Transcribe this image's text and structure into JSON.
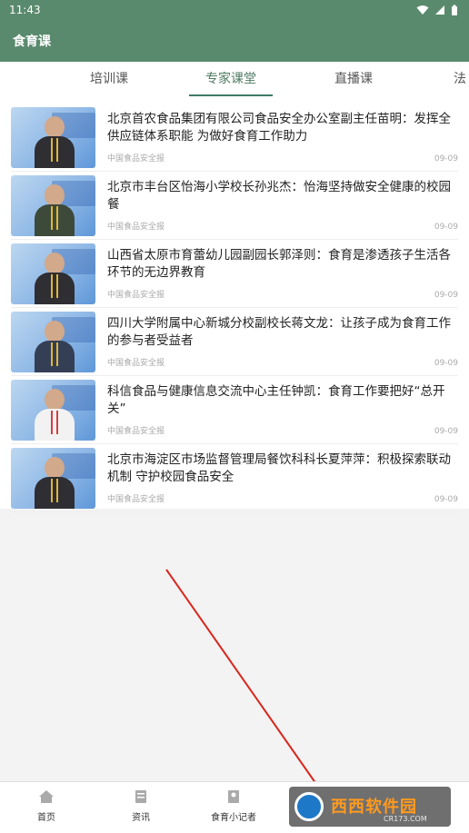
{
  "status": {
    "time": "11:43"
  },
  "app": {
    "title": "食育课"
  },
  "tabs": [
    {
      "label": "培训课"
    },
    {
      "label": "专家课堂",
      "active": true
    },
    {
      "label": "直播课"
    },
    {
      "label": "法"
    }
  ],
  "articles": [
    {
      "title": "北京首农食品集团有限公司食品安全办公室副主任苗明：发挥全供应链体系职能 为做好食育工作助力",
      "source": "中国食品安全报",
      "date": "09-09"
    },
    {
      "title": "北京市丰台区怡海小学校长孙兆杰：怡海坚持做安全健康的校园餐",
      "source": "中国食品安全报",
      "date": "09-09"
    },
    {
      "title": "山西省太原市育蕾幼儿园副园长郭泽则：食育是渗透孩子生活各环节的无边界教育",
      "source": "中国食品安全报",
      "date": "09-09"
    },
    {
      "title": "四川大学附属中心新城分校副校长蒋文龙：让孩子成为食育工作的参与者受益者",
      "source": "中国食品安全报",
      "date": "09-09"
    },
    {
      "title": "科信食品与健康信息交流中心主任钟凯：食育工作要把好“总开关”",
      "source": "中国食品安全报",
      "date": "09-09"
    },
    {
      "title": "北京市海淀区市场监督管理局餐饮科科长夏萍萍：积极探索联动机制 守护校园食品安全",
      "source": "中国食品安全报",
      "date": "09-09"
    }
  ],
  "bottom_nav": [
    {
      "label": "首页",
      "icon": "home-icon"
    },
    {
      "label": "资讯",
      "icon": "news-icon"
    },
    {
      "label": "食育小记者",
      "icon": "reporter-icon"
    }
  ],
  "watermark": {
    "text": "西西软件园",
    "sub": "CR173.COM"
  },
  "colors": {
    "primary": "#5a8a6d",
    "accent": "#3f7a65",
    "annotation": "#d9261c"
  }
}
